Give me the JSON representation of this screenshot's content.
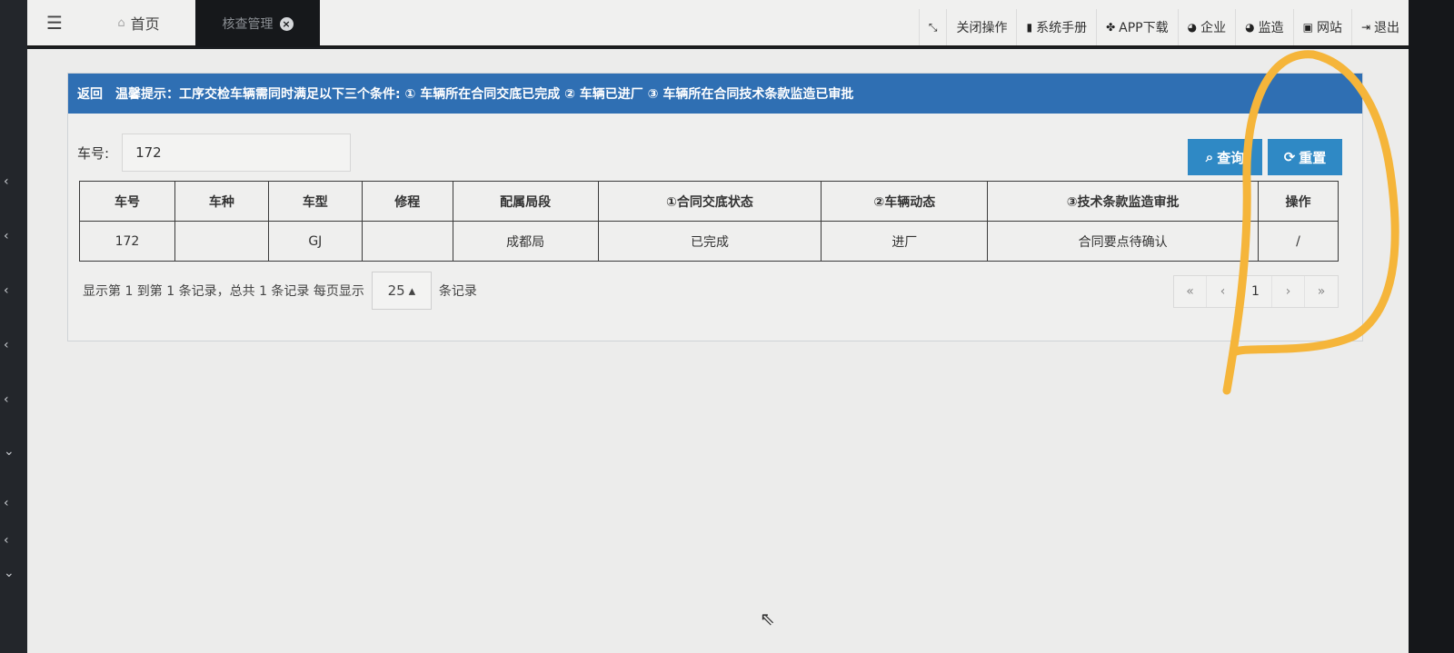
{
  "sidebar": {
    "arrows": [
      "‹",
      "‹",
      "‹",
      "‹",
      "‹",
      "⌄",
      "‹",
      "‹",
      "⌄"
    ]
  },
  "topbar": {
    "menu_icon": "☰",
    "home_tab": "首页",
    "active_tab": "核查管理",
    "actions": [
      {
        "icon": "⤡",
        "label": ""
      },
      {
        "icon": "",
        "label": "关闭操作"
      },
      {
        "icon": "▮",
        "label": "系统手册"
      },
      {
        "icon": "✤",
        "label": "APP下载"
      },
      {
        "icon": "◕",
        "label": "企业"
      },
      {
        "icon": "◕",
        "label": "监造"
      },
      {
        "icon": "▣",
        "label": "网站"
      },
      {
        "icon": "⇥",
        "label": "退出"
      }
    ]
  },
  "notice": {
    "back": "返回",
    "text": "温馨提示：工序交检车辆需同时满足以下三个条件: ① 车辆所在合同交底已完成 ② 车辆已进厂 ③ 车辆所在合同技术条款监造已审批"
  },
  "search": {
    "label": "车号:",
    "value": "172",
    "query_button": "查询",
    "reset_button": "重置"
  },
  "table": {
    "headers": [
      "车号",
      "车种",
      "车型",
      "修程",
      "配属局段",
      "①合同交底状态",
      "②车辆动态",
      "③技术条款监造审批",
      "操作"
    ],
    "rows": [
      [
        "172",
        "",
        "GJ",
        "",
        "成都局",
        "已完成",
        "进厂",
        "合同要点待确认",
        "/"
      ]
    ]
  },
  "footer": {
    "summary": "显示第 1 到第 1 条记录，总共 1 条记录 每页显示",
    "page_size": "25",
    "suffix": "条记录"
  },
  "pager": {
    "first": "«",
    "prev": "‹",
    "current": "1",
    "next": "›",
    "last": "»"
  },
  "colors": {
    "notice_bg": "#2f6fb3",
    "button_bg": "#2f89c5",
    "annotation": "#f5b53a"
  }
}
